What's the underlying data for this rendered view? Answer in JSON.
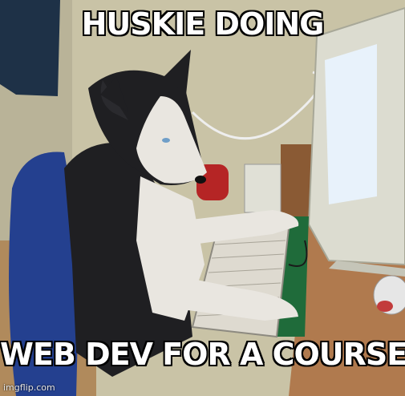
{
  "meme": {
    "top_text": "HUSKIE DOING",
    "bottom_text": "WEB DEV FOR A COURSE",
    "watermark": "imgflip.com"
  },
  "icons": {
    "subject": "husky-dog-icon",
    "monitor": "crt-monitor-icon",
    "keyboard": "keyboard-icon",
    "chair": "office-chair-icon",
    "mouse": "computer-mouse-icon"
  },
  "colors": {
    "wall": "#c9c3a6",
    "chair": "#24408f",
    "desk": "#b07a4e",
    "monitor": "#dcdcd0",
    "screen": "#e8f2fb",
    "fur_dark": "#1f1f22",
    "fur_light": "#e9e6e0"
  }
}
